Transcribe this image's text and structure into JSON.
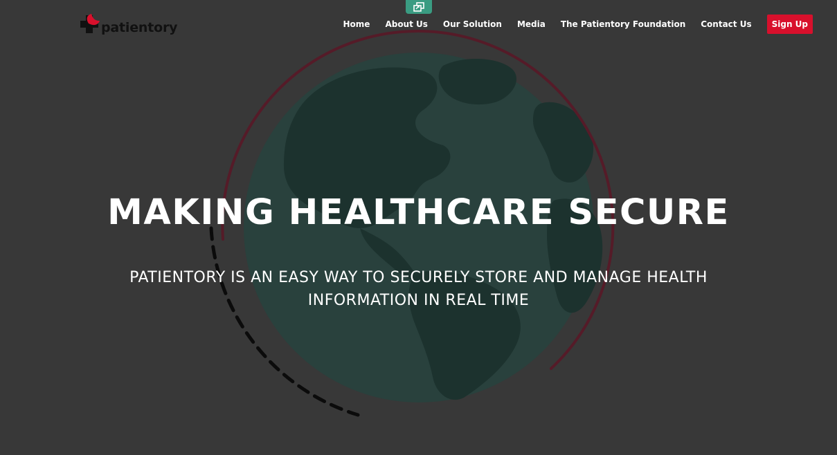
{
  "brand": {
    "name": "patientory",
    "accent_color": "#d8102c",
    "mark_dark_color": "#111111"
  },
  "top_tab": {
    "icon": "copy-window-icon",
    "color": "#3a9c82"
  },
  "nav": {
    "items": [
      {
        "label": "Home"
      },
      {
        "label": "About Us"
      },
      {
        "label": "Our Solution"
      },
      {
        "label": "Media"
      },
      {
        "label": "The Patientory Foundation"
      },
      {
        "label": "Contact Us"
      }
    ],
    "signup_label": "Sign Up"
  },
  "hero": {
    "title": "MAKING HEALTHCARE SECURE",
    "subtitle": "PATIENTORY IS AN EASY WAY TO SECURELY STORE AND MANAGE HEALTH INFORMATION IN REAL TIME",
    "globe_color": "#1f3f3a",
    "ring_color": "#5a1d2b",
    "background_color": "#3b3b3b"
  }
}
